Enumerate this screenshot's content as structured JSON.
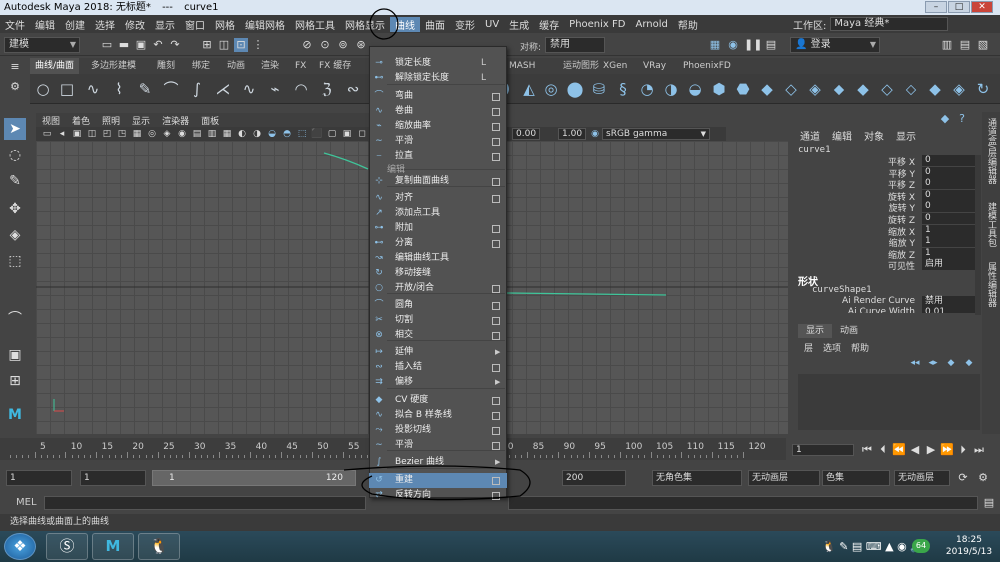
{
  "window": {
    "app_title": "Autodesk Maya 2018: 无标题*",
    "separator": "---",
    "object": "curve1",
    "minimize": "–",
    "maximize": "□",
    "close": "✕"
  },
  "menubar": {
    "items": [
      "文件",
      "编辑",
      "创建",
      "选择",
      "修改",
      "显示",
      "窗口",
      "网格",
      "编辑网格",
      "网格工具",
      "网格显示",
      "曲线",
      "曲面",
      "变形",
      "UV",
      "生成",
      "缓存",
      "Phoenix FD",
      "Arnold",
      "帮助"
    ],
    "active_index": 11,
    "workspace_label": "工作区:",
    "workspace_value": "Maya 经典*"
  },
  "statusline": {
    "mode": "建模",
    "symmetry_label": "对称:",
    "symmetry_value": "禁用",
    "login": "登录"
  },
  "shelf": {
    "tabs": [
      "曲线/曲面",
      "多边形建模",
      "雕刻",
      "绑定",
      "动画",
      "渲染",
      "FX",
      "FX 缓存",
      "MASH",
      "运动图形",
      "XGen",
      "VRay",
      "PhoenixFD"
    ],
    "active_index": 0
  },
  "viewport": {
    "menu": [
      "视图",
      "着色",
      "照明",
      "显示",
      "渲染器",
      "面板"
    ],
    "field_a": "0.00",
    "field_b": "1.00",
    "color_space": "sRGB gamma"
  },
  "channel_box": {
    "tabs": [
      "通道",
      "编辑",
      "对象",
      "显示"
    ],
    "object": "curve1",
    "attrs": [
      {
        "name": "平移 X",
        "value": "0"
      },
      {
        "name": "平移 Y",
        "value": "0"
      },
      {
        "name": "平移 Z",
        "value": "0"
      },
      {
        "name": "旋转 X",
        "value": "0"
      },
      {
        "name": "旋转 Y",
        "value": "0"
      },
      {
        "name": "旋转 Z",
        "value": "0"
      },
      {
        "name": "缩放 X",
        "value": "1"
      },
      {
        "name": "缩放 Y",
        "value": "1"
      },
      {
        "name": "缩放 Z",
        "value": "1"
      },
      {
        "name": "可见性",
        "value": "启用"
      }
    ],
    "shapes_title": "形状",
    "shape_name": "curveShape1",
    "shape_attrs": [
      {
        "name": "Ai Render Curve",
        "value": "禁用"
      },
      {
        "name": "Ai Curve Width",
        "value": "0.01"
      }
    ],
    "side_tabs": [
      "通道盒/层编辑器",
      "建模工具包",
      "属性编辑器"
    ]
  },
  "layer_editor": {
    "tabs": [
      "显示",
      "动画"
    ],
    "menu": [
      "层",
      "选项",
      "帮助"
    ]
  },
  "curve_menu": {
    "items": [
      {
        "label": "锁定长度",
        "key": "L"
      },
      {
        "label": "解除锁定长度",
        "key": "L"
      },
      {
        "label": "弯曲",
        "box": true
      },
      {
        "label": "卷曲",
        "box": true
      },
      {
        "label": "缩放曲率",
        "box": true
      },
      {
        "label": "平滑",
        "box": true
      },
      {
        "label": "拉直",
        "box": true
      },
      {
        "label": "复制曲面曲线",
        "box": true
      },
      {
        "label": "对齐",
        "box": true
      },
      {
        "label": "添加点工具"
      },
      {
        "label": "附加",
        "box": true
      },
      {
        "label": "分离",
        "box": true
      },
      {
        "label": "编辑曲线工具"
      },
      {
        "label": "移动接缝"
      },
      {
        "label": "开放/闭合",
        "box": true
      },
      {
        "label": "圆角",
        "box": true
      },
      {
        "label": "切割",
        "box": true
      },
      {
        "label": "相交",
        "box": true
      },
      {
        "label": "延伸",
        "arrow": true
      },
      {
        "label": "插入结",
        "box": true
      },
      {
        "label": "偏移",
        "arrow": true
      },
      {
        "label": "CV 硬度",
        "box": true
      },
      {
        "label": "拟合 B 样条线",
        "box": true
      },
      {
        "label": "投影切线",
        "box": true
      },
      {
        "label": "平滑",
        "box": true
      },
      {
        "label": "Bezier 曲线",
        "arrow": true
      },
      {
        "label": "重建",
        "box": true,
        "highlight": true
      },
      {
        "label": "反转方向",
        "box": true
      }
    ],
    "section_edit": "编辑"
  },
  "timeline": {
    "ticks": [
      "5",
      "10",
      "15",
      "20",
      "25",
      "30",
      "35",
      "40",
      "45",
      "50",
      "55",
      "60",
      "65",
      "70",
      "75",
      "80",
      "85",
      "90",
      "95",
      "100",
      "105",
      "110",
      "115",
      "120"
    ],
    "current_frame": "1"
  },
  "range": {
    "start": "1",
    "playback_start": "1",
    "slider_start": "1",
    "slider_end": "120",
    "end": "200",
    "char_set": "无角色集",
    "anim_layer": "无动画层",
    "fps_a": "色集",
    "fps_b": "无动画层"
  },
  "mel": {
    "label": "MEL"
  },
  "helpline": "选择曲线或曲面上的曲线",
  "taskbar": {
    "time": "18:25",
    "date": "2019/5/13",
    "badge": "64"
  }
}
